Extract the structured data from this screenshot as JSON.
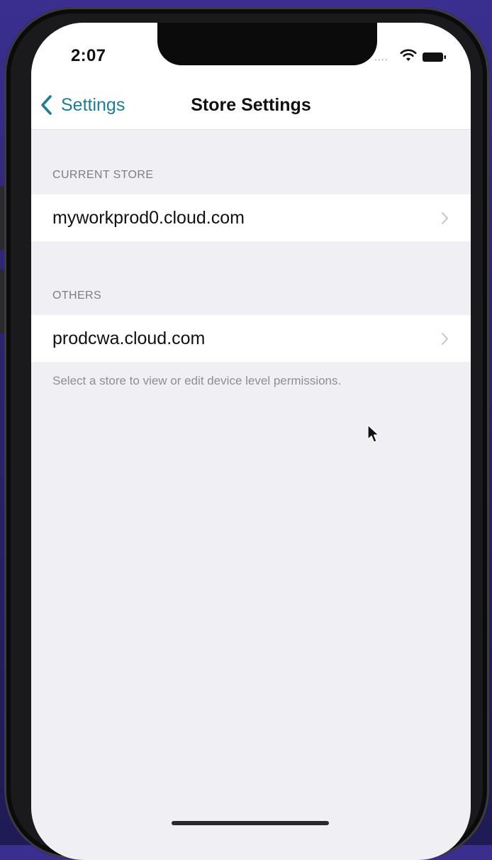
{
  "status_bar": {
    "time": "2:07",
    "signal_dots": "....",
    "wifi_icon": "wifi-icon",
    "battery_icon": "battery-icon"
  },
  "nav": {
    "back_label": "Settings",
    "back_icon": "chevron-left-icon",
    "title": "Store Settings"
  },
  "sections": {
    "current": {
      "header": "CURRENT STORE",
      "store": "myworkprod0.cloud.com"
    },
    "others": {
      "header": "OTHERS",
      "store": "prodcwa.cloud.com"
    },
    "footer": "Select a store to view or edit device level permissions."
  },
  "colors": {
    "accent": "#1f7d93",
    "background": "#efeff4",
    "row": "#ffffff",
    "secondary_text": "#8e8e93"
  }
}
